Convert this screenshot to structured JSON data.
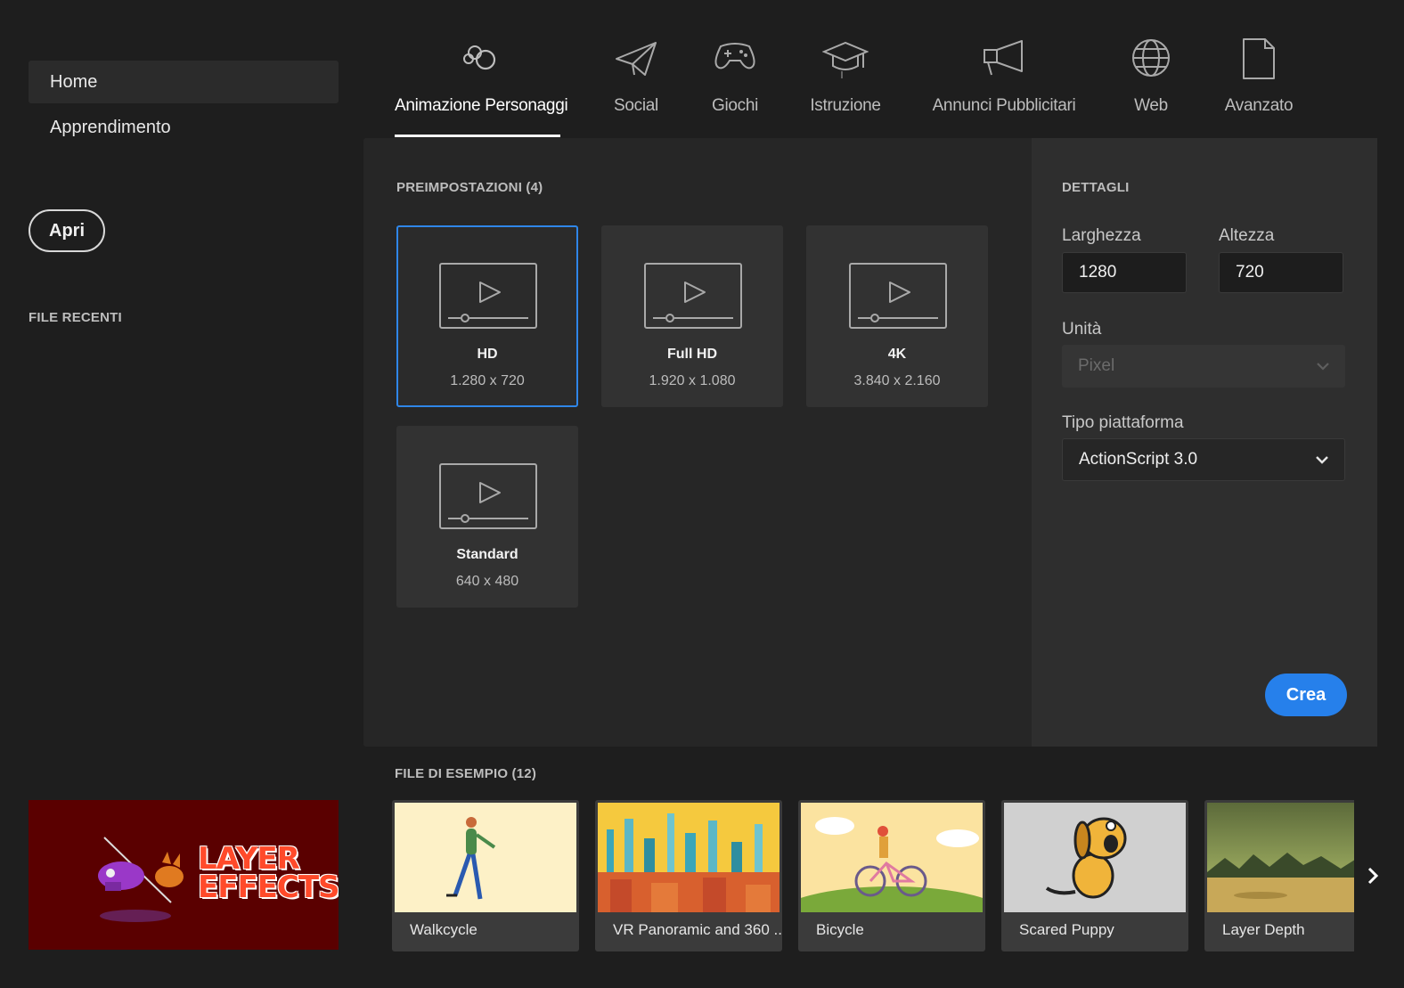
{
  "sidebar": {
    "items": [
      {
        "label": "Home",
        "active": true
      },
      {
        "label": "Apprendimento",
        "active": false
      }
    ],
    "open_button": "Apri",
    "recent_files_title": "FILE RECENTI",
    "promo": {
      "line1": "LAYER",
      "line2": "EFFECTS"
    }
  },
  "tabs": [
    {
      "label": "Animazione Personaggi",
      "icon": "character-animation-icon",
      "active": true
    },
    {
      "label": "Social",
      "icon": "paper-plane-icon",
      "active": false
    },
    {
      "label": "Giochi",
      "icon": "gamepad-icon",
      "active": false
    },
    {
      "label": "Istruzione",
      "icon": "graduation-cap-icon",
      "active": false
    },
    {
      "label": "Annunci Pubblicitari",
      "icon": "megaphone-icon",
      "active": false
    },
    {
      "label": "Web",
      "icon": "globe-icon",
      "active": false
    },
    {
      "label": "Avanzato",
      "icon": "document-icon",
      "active": false
    }
  ],
  "presets": {
    "title": "PREIMPOSTAZIONI (4)",
    "items": [
      {
        "name": "HD",
        "size": "1.280 x 720",
        "selected": true
      },
      {
        "name": "Full HD",
        "size": "1.920 x 1.080",
        "selected": false
      },
      {
        "name": "4K",
        "size": "3.840 x 2.160",
        "selected": false
      },
      {
        "name": "Standard",
        "size": "640 x 480",
        "selected": false
      }
    ]
  },
  "details": {
    "title": "DETTAGLI",
    "width_label": "Larghezza",
    "width_value": "1280",
    "height_label": "Altezza",
    "height_value": "720",
    "unit_label": "Unità",
    "unit_value": "Pixel",
    "platform_label": "Tipo piattaforma",
    "platform_value": "ActionScript 3.0",
    "create_button": "Crea"
  },
  "samples": {
    "title": "FILE DI ESEMPIO (12)",
    "items": [
      {
        "label": "Walkcycle"
      },
      {
        "label": "VR Panoramic and 360 ..."
      },
      {
        "label": "Bicycle"
      },
      {
        "label": "Scared Puppy"
      },
      {
        "label": "Layer Depth"
      }
    ]
  },
  "colors": {
    "background": "#1e1e1e",
    "accent": "#2680eb",
    "selected_border": "#2f86e8"
  }
}
